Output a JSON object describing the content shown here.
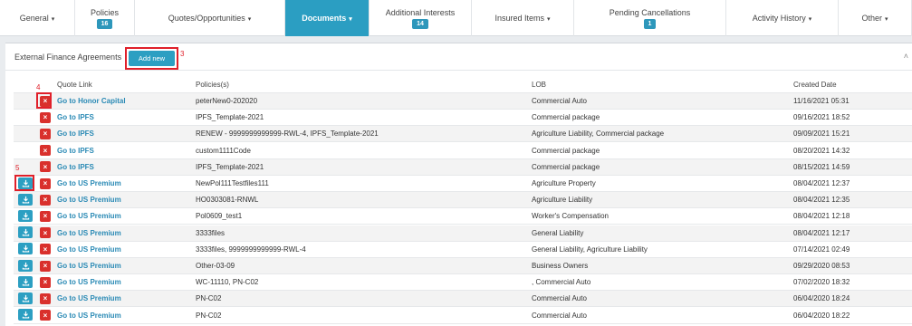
{
  "nav": {
    "tabs": [
      {
        "label": "General",
        "caret": true,
        "width": 83
      },
      {
        "label": "Policies",
        "badge": "16",
        "width": 66
      },
      {
        "label": "Quotes/Opportunities",
        "caret": true,
        "width": 166
      },
      {
        "label": "Documents",
        "caret": true,
        "active": true,
        "width": 93
      },
      {
        "label": "Additional Interests",
        "badge": "14",
        "width": 113
      },
      {
        "label": "Insured Items",
        "caret": true,
        "width": 113
      },
      {
        "label": "Pending Cancellations",
        "badge": "1",
        "width": 168
      },
      {
        "label": "Activity History",
        "caret": true,
        "width": 124
      },
      {
        "label": "Other",
        "caret": true,
        "width": 81
      }
    ]
  },
  "panel": {
    "title": "External Finance Agreements",
    "add_new_label": "Add new",
    "collapse_icon": "chevron-up-icon"
  },
  "annotations": {
    "a3": "3",
    "a4": "4",
    "a5": "5"
  },
  "table": {
    "headers": {
      "quote_link": "Quote Link",
      "policies": "Policies(s)",
      "lob": "LOB",
      "created": "Created Date"
    },
    "rows": [
      {
        "download": false,
        "link": "Go to Honor Capital",
        "policies": "peterNew0-202020",
        "lob": "Commercial Auto",
        "created": "11/16/2021 05:31"
      },
      {
        "download": false,
        "link": "Go to IPFS",
        "policies": "IPFS_Template-2021",
        "lob": "Commercial package",
        "created": "09/16/2021 18:52"
      },
      {
        "download": false,
        "link": "Go to IPFS",
        "policies": "RENEW - 9999999999999-RWL-4, IPFS_Template-2021",
        "lob": "Agriculture Liability, Commercial package",
        "created": "09/09/2021 15:21"
      },
      {
        "download": false,
        "link": "Go to IPFS",
        "policies": "custom1111Code",
        "lob": "Commercial package",
        "created": "08/20/2021 14:32"
      },
      {
        "download": false,
        "link": "Go to IPFS",
        "policies": "IPFS_Template-2021",
        "lob": "Commercial package",
        "created": "08/15/2021 14:59"
      },
      {
        "download": true,
        "link": "Go to US Premium",
        "policies": "NewPol111Testfiles111",
        "lob": "Agriculture Property",
        "created": "08/04/2021 12:37"
      },
      {
        "download": true,
        "link": "Go to US Premium",
        "policies": "HO0303081-RNWL",
        "lob": "Agriculture Liability",
        "created": "08/04/2021 12:35"
      },
      {
        "download": true,
        "link": "Go to US Premium",
        "policies": "Pol0609_test1",
        "lob": "Worker's Compensation",
        "created": "08/04/2021 12:18"
      },
      {
        "download": true,
        "link": "Go to US Premium",
        "policies": "3333files",
        "lob": "General Liability",
        "created": "08/04/2021 12:17"
      },
      {
        "download": true,
        "link": "Go to US Premium",
        "policies": "3333files, 9999999999999-RWL-4",
        "lob": "General Liability, Agriculture Liability",
        "created": "07/14/2021 02:49"
      },
      {
        "download": true,
        "link": "Go to US Premium",
        "policies": "Other-03-09",
        "lob": "Business Owners",
        "created": "09/29/2020 08:53"
      },
      {
        "download": true,
        "link": "Go to US Premium",
        "policies": "WC-11110, PN-C02",
        "lob": ", Commercial Auto",
        "created": "07/02/2020 18:32"
      },
      {
        "download": true,
        "link": "Go to US Premium",
        "policies": "PN-C02",
        "lob": "Commercial Auto",
        "created": "06/04/2020 18:24"
      },
      {
        "download": true,
        "link": "Go to US Premium",
        "policies": "PN-C02",
        "lob": "Commercial Auto",
        "created": "06/04/2020 18:22"
      }
    ]
  }
}
